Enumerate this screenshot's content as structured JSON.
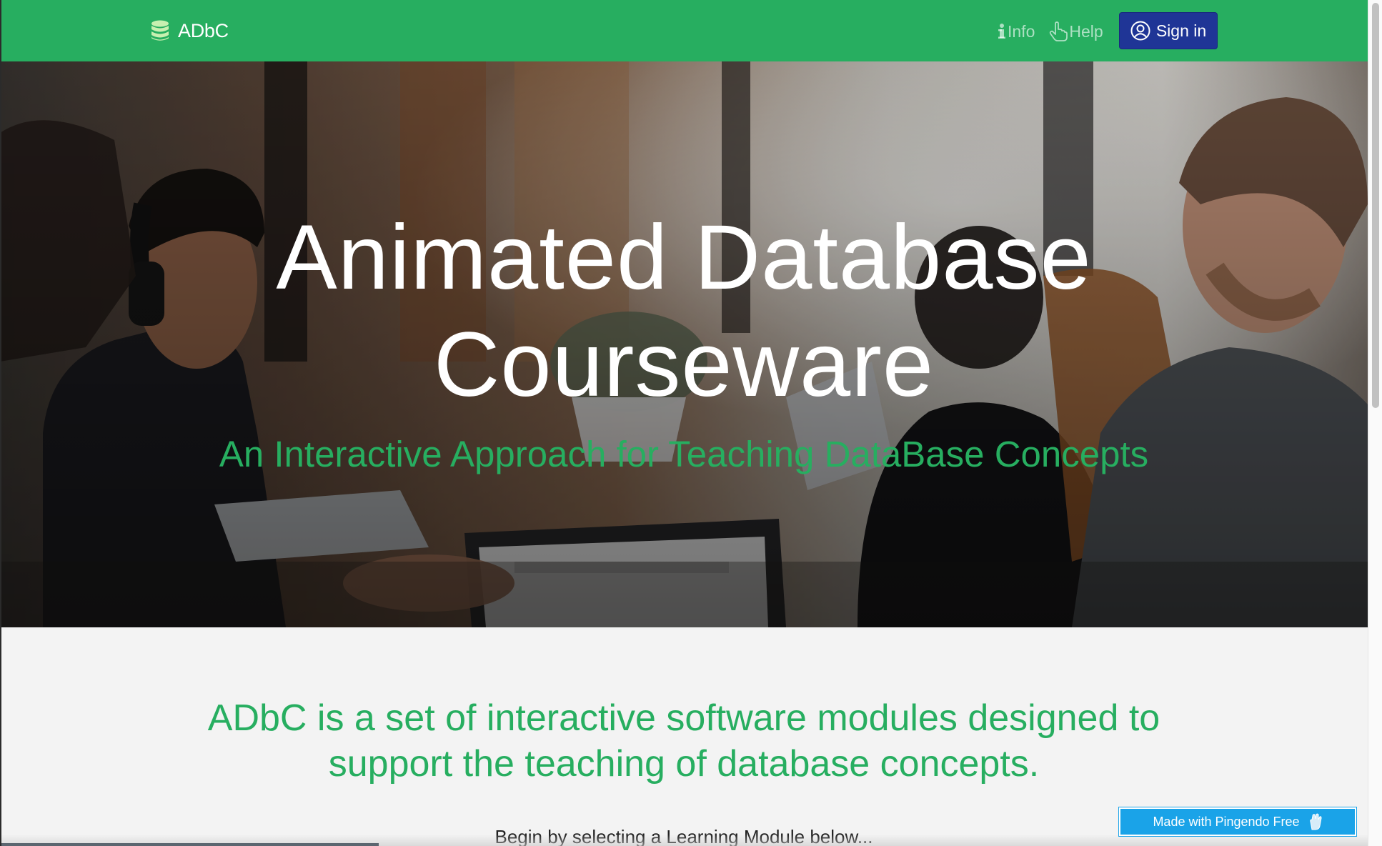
{
  "navbar": {
    "brand": "ADbC",
    "brand_icon": "database-icon",
    "links": [
      {
        "label": "Info",
        "icon": "info-icon"
      },
      {
        "label": "Help",
        "icon": "pointing-hand-icon"
      }
    ],
    "signin_label": "Sign in",
    "signin_icon": "user-circle-icon"
  },
  "hero": {
    "title_line1": "Animated Database",
    "title_line2": "Courseware",
    "subtitle": "An Interactive Approach for Teaching DataBase Concepts"
  },
  "intro": {
    "heading_line1": "ADbC is a set of interactive software modules designed to",
    "heading_line2": "support the teaching of database concepts.",
    "text": "Begin by selecting a Learning Module below..."
  },
  "badge": {
    "label": "Made with Pingendo Free",
    "icon": "pingendo-hand-icon"
  },
  "colors": {
    "navbar": "#27ae60",
    "accent_green": "#27ae60",
    "signin_button": "#1f3596",
    "badge": "#1aa3e8",
    "section_bg": "#f3f3f3"
  }
}
